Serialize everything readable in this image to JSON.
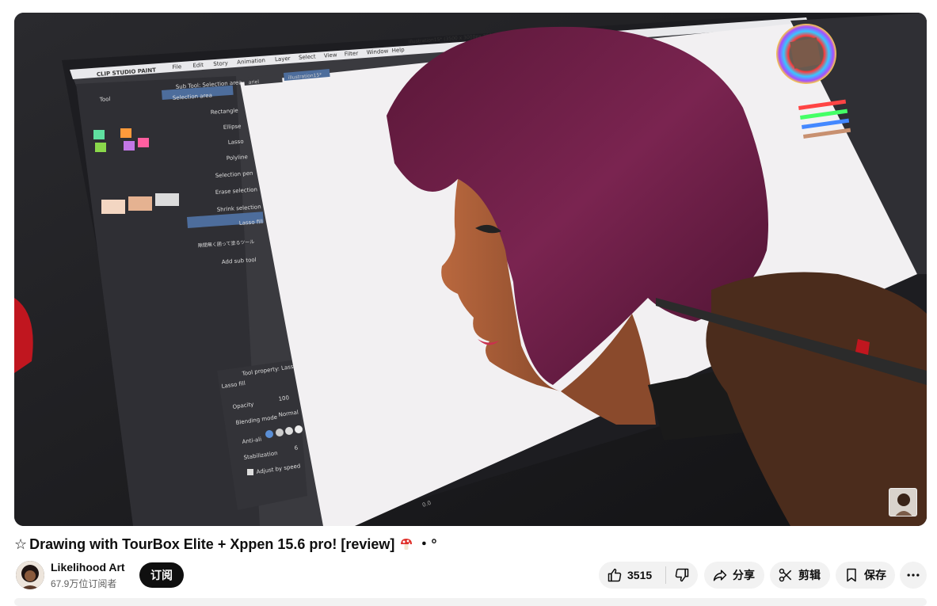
{
  "video": {
    "app_menu": {
      "app_name": "CLIP STUDIO PAINT",
      "items": [
        "File",
        "Edit",
        "Story",
        "Animation",
        "Layer",
        "Select",
        "View",
        "Filter",
        "Window",
        "Help"
      ],
      "doc_title": "illustration15* (3500 x 3000px 300dpi 60.7%) - CLIP STUDIO PAINT EX"
    },
    "tool_panel": {
      "tool_label": "Tool",
      "subtool_header": "Sub Tool: Selection area",
      "tab_label": "Selection area",
      "subtools": [
        "Rectangle",
        "Ellipse",
        "Lasso",
        "Polyline",
        "Selection pen",
        "Erase selection",
        "Shrink selection",
        "Lasso fill",
        "隙間無く囲って塗るツール"
      ],
      "add_sub_tool": "Add sub tool"
    },
    "tool_property": {
      "header": "Tool property: Lasso fill",
      "name": "Lasso fill",
      "opacity_label": "Opacity",
      "opacity_value": "100",
      "blending_label": "Blending mode",
      "blending_value": "Normal",
      "antialias_label": "Anti-ali",
      "stabilization_label": "Stabilization",
      "stabilization_value": "6",
      "adjust_label": "Adjust by speed"
    },
    "canvas_tabs": [
      "ariel",
      "illustration15*"
    ],
    "zoom_readout": "0.0"
  },
  "title": {
    "prefix": "☆",
    "text": "Drawing with TourBox Elite + Xppen 15.6 pro! [review]",
    "suffix": "・°"
  },
  "channel": {
    "name": "Likelihood Art",
    "subscribers": "67.9万位订阅者",
    "subscribe_label": "订阅"
  },
  "actions": {
    "like_count": "3515",
    "share_label": "分享",
    "clip_label": "剪辑",
    "save_label": "保存"
  },
  "icons": {
    "like": "thumbs-up-icon",
    "dislike": "thumbs-down-icon",
    "share": "share-arrow-icon",
    "clip": "scissors-icon",
    "save": "bookmark-icon",
    "more": "more-horizontal-icon"
  }
}
